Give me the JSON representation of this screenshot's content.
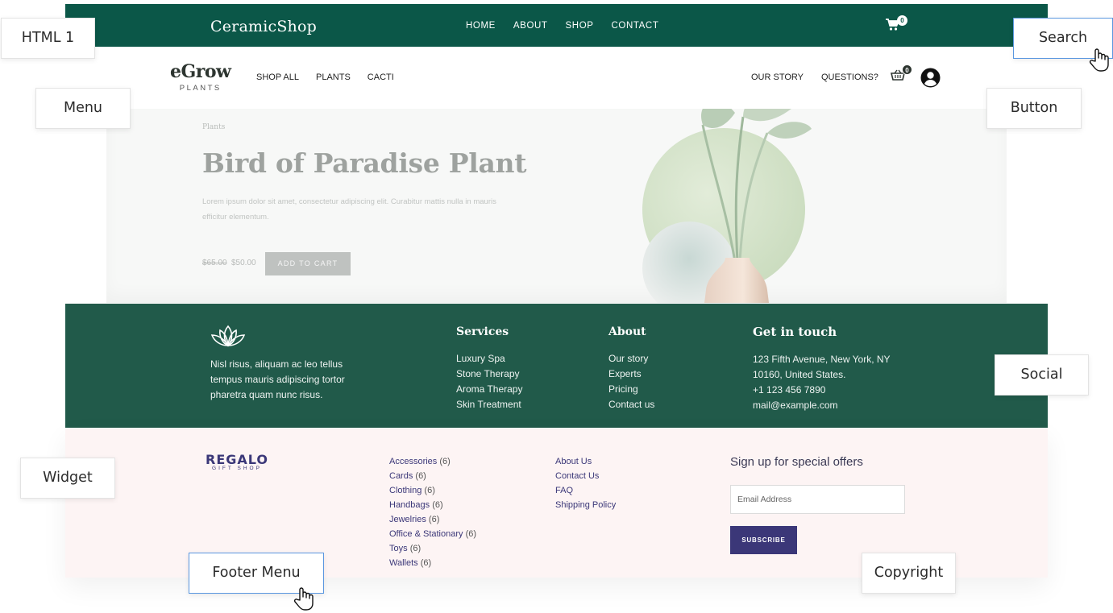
{
  "topbar": {
    "brand": "CeramicShop",
    "nav": [
      "HOME",
      "ABOUT",
      "SHOP",
      "CONTACT"
    ],
    "cart_count": "0"
  },
  "header2": {
    "logo_main": "eGrow",
    "logo_sub": "PLANTS",
    "menu_left": [
      "SHOP ALL",
      "PLANTS",
      "CACTI"
    ],
    "menu_right": [
      "OUR STORY",
      "QUESTIONS?"
    ],
    "basket_count": "0"
  },
  "hero": {
    "breadcrumb": "Plants",
    "title": "Bird of Paradise Plant",
    "description": "Lorem ipsum dolor sit amet, consectetur adipiscing elit. Curabitur mattis nulla in mauris efficitur elementum.",
    "old_price": "$65.00",
    "new_price": "$50.00",
    "cart_button": "ADD TO CART"
  },
  "green_footer": {
    "about_text": "Nisl risus, aliquam ac leo tellus tempus mauris adipiscing tortor pharetra quam nunc risus.",
    "services": {
      "heading": "Services",
      "items": [
        "Luxury Spa",
        "Stone Therapy",
        "Aroma Therapy",
        "Skin Treatment"
      ]
    },
    "about": {
      "heading": "About",
      "items": [
        "Our story",
        "Experts",
        "Pricing",
        "Contact us"
      ]
    },
    "contact": {
      "heading": "Get in touch",
      "lines": [
        "123 Fifth Avenue, New York, NY",
        "10160, United States.",
        "+1 123 456 7890",
        "mail@example.com"
      ]
    }
  },
  "pink_footer": {
    "logo_main": "REGALO",
    "logo_sub": "GIFT SHOP",
    "categories": [
      {
        "name": "Accessories",
        "count": "(6)"
      },
      {
        "name": "Cards",
        "count": "(6)"
      },
      {
        "name": "Clothing",
        "count": "(6)"
      },
      {
        "name": "Handbags",
        "count": "(6)"
      },
      {
        "name": "Jewelries",
        "count": "(6)"
      },
      {
        "name": "Office & Stationary",
        "count": "(6)"
      },
      {
        "name": "Toys",
        "count": "(6)"
      },
      {
        "name": "Wallets",
        "count": "(6)"
      }
    ],
    "links": [
      "About Us",
      "Contact Us",
      "FAQ",
      "Shipping Policy"
    ],
    "signup_heading": "Sign up for special offers",
    "email_placeholder": "Email Address",
    "subscribe_button": "SUBSCRIBE"
  },
  "callouts": {
    "html1": "HTML  1",
    "search": "Search",
    "menu": "Menu",
    "button": "Button",
    "social": "Social",
    "widget": "Widget",
    "footer_menu": "Footer  Menu",
    "copyright": "Copyright"
  },
  "colors": {
    "topbar": "#0b5748",
    "green_footer": "#215a4a",
    "pink_footer": "#fdf4f4",
    "regalo_accent": "#3b3778"
  },
  "icons": [
    "cart-icon",
    "basket-icon",
    "user-icon",
    "lotus-icon",
    "pointer-hand-icon"
  ]
}
